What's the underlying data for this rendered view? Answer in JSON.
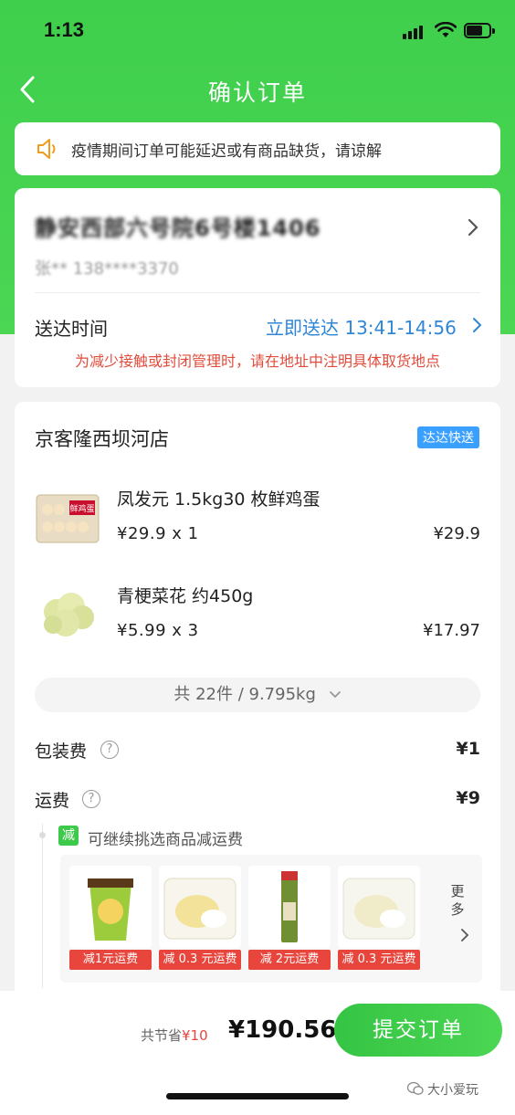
{
  "status_bar": {
    "time": "1:13"
  },
  "nav": {
    "title": "确认订单"
  },
  "notice": {
    "text": "疫情期间订单可能延迟或有商品缺货，请谅解"
  },
  "address": {
    "line": "静安西部六号院6号楼1406",
    "contact": "张**  138****3370",
    "delivery_label": "送达时间",
    "delivery_value": "立即送达 13:41-14:56",
    "delivery_note": "为减少接触或封闭管理时，请在地址中注明具体取货地点"
  },
  "store": {
    "name": "京客隆西坝河店",
    "badge": "达达快送",
    "items": [
      {
        "name": "凤发元 1.5kg30 枚鲜鸡蛋",
        "price": "¥29.9   x  1",
        "subtotal": "¥29.9"
      },
      {
        "name": "青梗菜花 约450g",
        "price": "¥5.99   x  3",
        "subtotal": "¥17.97"
      }
    ],
    "summary": "共 22件 / 9.795kg",
    "packaging_label": "包装费",
    "packaging_value": "¥1",
    "shipping_label": "运费",
    "shipping_value": "¥9",
    "help_glyph": "?",
    "reduce_badge": "减",
    "reduce_text": "可继续挑选商品减运费",
    "recommendations": [
      {
        "tag": "减1元运费",
        "color": "#8bc34a"
      },
      {
        "tag": "减 0.3 元运费",
        "color": "#f3e9a8"
      },
      {
        "tag": "减 2元运费",
        "color": "#7a8f3a"
      },
      {
        "tag": "减 0.3 元运费",
        "color": "#f1f1e6"
      }
    ],
    "more_label_1": "更",
    "more_label_2": "多"
  },
  "egg_box_text": "鲜鸡蛋",
  "bottom": {
    "save_prefix": "共节省",
    "save_amount": "¥10",
    "total": "¥190.56",
    "submit": "提交订单"
  },
  "watermark": "大小爱玩",
  "colors": {
    "primary_green": "#3fcf4c",
    "link_blue": "#2f86d6",
    "alert_red": "#e24b3b",
    "badge_blue": "#3aa0ff"
  }
}
